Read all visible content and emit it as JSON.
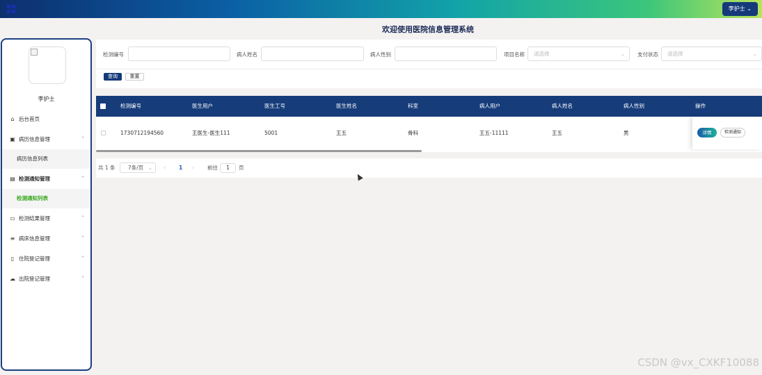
{
  "topbar": {
    "user_menu": "李护士 ⌄"
  },
  "sidebar": {
    "user_name": "李护士",
    "items": [
      {
        "label": "后台首页",
        "icon": "home-icon"
      },
      {
        "label": "病历信息管理",
        "icon": "inbox-icon",
        "sub": [
          "病历信息列表"
        ]
      },
      {
        "label": "检测通知管理",
        "icon": "clipboard-icon",
        "sub": [
          "检测通知列表"
        ]
      },
      {
        "label": "检测结果管理",
        "icon": "archive-icon"
      },
      {
        "label": "病床信息管理",
        "icon": "list-icon"
      },
      {
        "label": "住院登记管理",
        "icon": "document-icon"
      },
      {
        "label": "出院登记管理",
        "icon": "cloud-upload-icon"
      }
    ]
  },
  "header": {
    "title": "欢迎使用医院信息管理系统"
  },
  "filters": {
    "code_label": "检测编号",
    "code_value": "",
    "patient_name_label": "病人姓名",
    "patient_name_value": "",
    "gender_label": "病人性别",
    "gender_value": "",
    "item_label": "项目名称",
    "item_placeholder": "请选择",
    "pay_label": "支付状态",
    "pay_placeholder": "请选择",
    "search_label": "查询",
    "reset_label": "重置"
  },
  "table": {
    "headers": [
      "检测编号",
      "医生用户",
      "医生工号",
      "医生姓名",
      "科室",
      "病人用户",
      "病人姓名",
      "病人性别",
      "操作"
    ],
    "rows": [
      [
        "1730712194560",
        "王医生-医生111",
        "5001",
        "王五",
        "骨科",
        "王五-11111",
        "王五",
        "男"
      ]
    ],
    "detail_label": "详情",
    "notify_label": "检测通知"
  },
  "pager": {
    "total": "共 1 条",
    "page_size": "7条/页",
    "prev": "‹",
    "current": "1",
    "next": "›",
    "goto": "前往",
    "goto_value": "1",
    "page_suffix": "页"
  },
  "watermark": "CSDN @vx_CXKF10088"
}
